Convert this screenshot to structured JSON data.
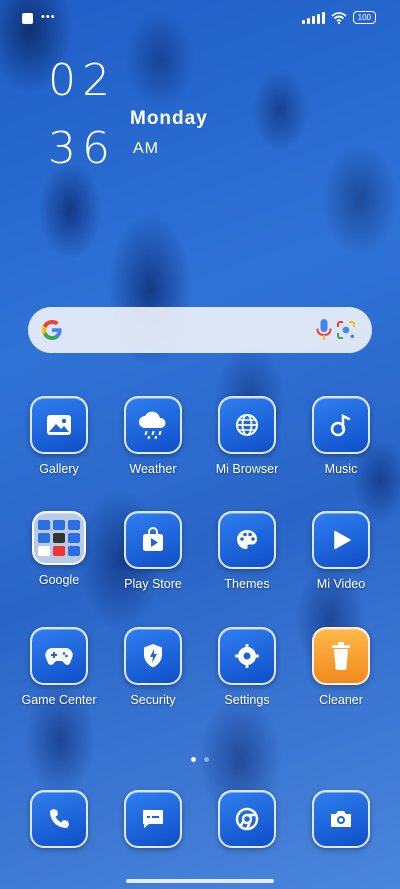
{
  "statusbar": {
    "battery": "100"
  },
  "clock": {
    "hours": "02",
    "minutes": "36",
    "day": "Monday",
    "ampm": "AM"
  },
  "search": {
    "icons": [
      "google-g-icon",
      "microphone-icon",
      "google-lens-icon"
    ]
  },
  "apps_row1": [
    {
      "label": "Gallery",
      "icon": "image-icon"
    },
    {
      "label": "Weather",
      "icon": "cloud-rain-icon"
    },
    {
      "label": "Mi Browser",
      "icon": "globe-icon"
    },
    {
      "label": "Music",
      "icon": "music-note-icon"
    }
  ],
  "apps_row2": [
    {
      "label": "Google",
      "icon": "folder-icon"
    },
    {
      "label": "Play Store",
      "icon": "play-store-icon"
    },
    {
      "label": "Themes",
      "icon": "palette-icon"
    },
    {
      "label": "Mi Video",
      "icon": "play-icon"
    }
  ],
  "apps_row3": [
    {
      "label": "Game Center",
      "icon": "gamepad-icon"
    },
    {
      "label": "Security",
      "icon": "shield-icon"
    },
    {
      "label": "Settings",
      "icon": "gear-icon"
    },
    {
      "label": "Cleaner",
      "icon": "trash-icon"
    }
  ],
  "dock": [
    {
      "icon": "phone-icon"
    },
    {
      "icon": "message-icon"
    },
    {
      "icon": "chrome-icon"
    },
    {
      "icon": "camera-icon"
    }
  ],
  "pager": {
    "pages": 2,
    "current": 1
  },
  "colors": {
    "tile": "#1f63d8",
    "cleaner": "#f6a23a",
    "wallpaper": "#2a66c8"
  }
}
